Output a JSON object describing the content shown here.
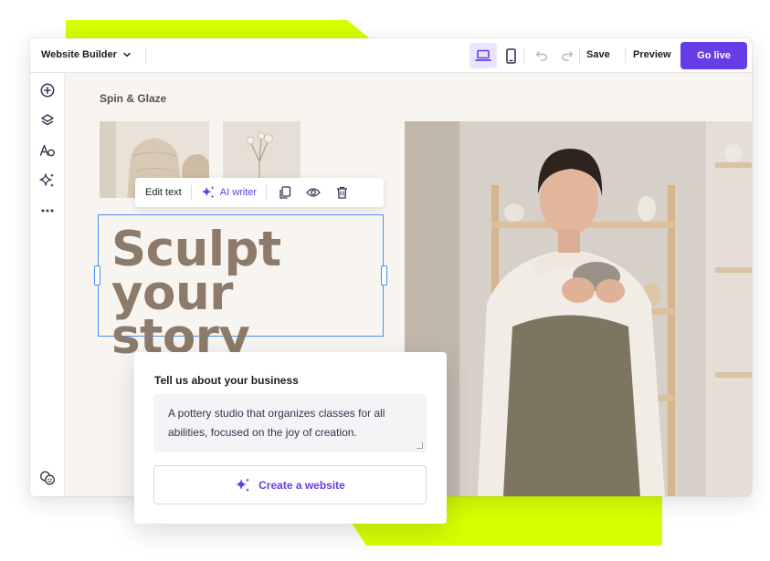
{
  "header": {
    "title": "Website Builder",
    "save_label": "Save",
    "preview_label": "Preview",
    "golive_label": "Go live"
  },
  "sidebar": {
    "items": [
      {
        "icon": "add-icon"
      },
      {
        "icon": "layers-icon"
      },
      {
        "icon": "typography-icon"
      },
      {
        "icon": "ai-sparkle-icon"
      },
      {
        "icon": "more-icon"
      }
    ],
    "footer_icon": "help-icon"
  },
  "canvas": {
    "brand": "Spin & Glaze",
    "heading_line1": "Sculpt",
    "heading_line2": "your story"
  },
  "text_toolbar": {
    "edit_label": "Edit text",
    "ai_label": "AI writer"
  },
  "ai_card": {
    "title": "Tell us about your business",
    "description": "A pottery studio that organizes classes for all abilities, focused on the joy of creation.",
    "button_label": "Create a website"
  },
  "colors": {
    "accent": "#673de6",
    "highlight": "#d6ff00",
    "heading": "#8c7b6a",
    "selection": "#4a8df8"
  }
}
